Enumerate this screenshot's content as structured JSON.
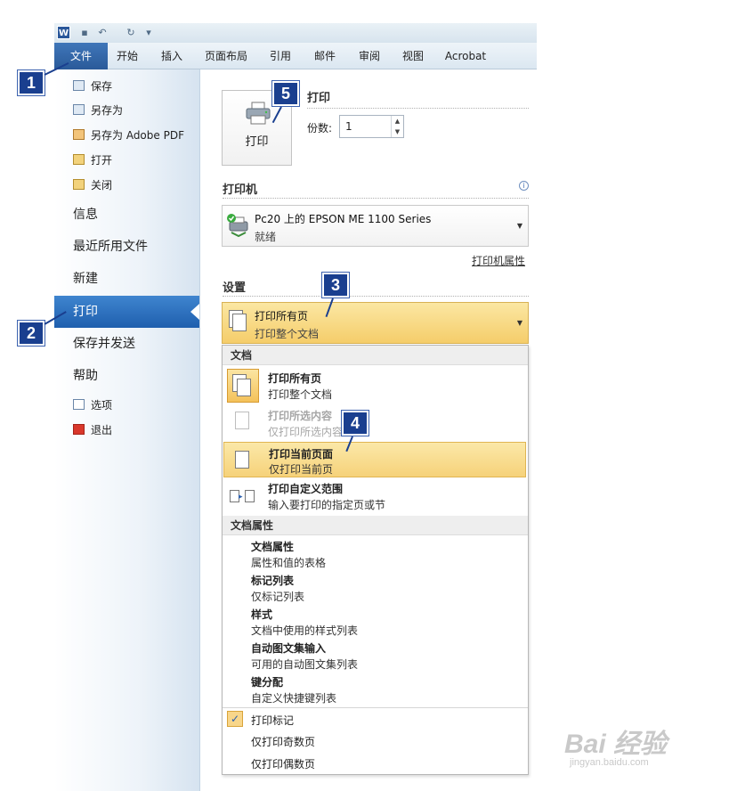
{
  "app": {
    "logo_letter": "W"
  },
  "ribbon_tabs": [
    "文件",
    "开始",
    "插入",
    "页面布局",
    "引用",
    "邮件",
    "审阅",
    "视图",
    "Acrobat"
  ],
  "nav": {
    "small_items": [
      "保存",
      "另存为",
      "另存为 Adobe PDF",
      "打开",
      "关闭"
    ],
    "big_items": [
      "信息",
      "最近所用文件",
      "新建",
      "打印",
      "保存并发送",
      "帮助"
    ],
    "bottom_items": [
      "选项",
      "退出"
    ]
  },
  "print": {
    "section_title": "打印",
    "button_label": "打印",
    "copies_label": "份数:",
    "copies_value": "1"
  },
  "printer": {
    "section_title": "打印机",
    "name": "Pc20 上的 EPSON ME 1100 Series",
    "status": "就绪",
    "properties_link": "打印机属性",
    "info_icon": "i"
  },
  "settings": {
    "section_title": "设置",
    "selected_title": "打印所有页",
    "selected_sub": "打印整个文档"
  },
  "dropdown": {
    "group1_header": "文档",
    "items": [
      {
        "title": "打印所有页",
        "sub": "打印整个文档"
      },
      {
        "title": "打印所选内容",
        "sub": "仅打印所选内容"
      },
      {
        "title": "打印当前页面",
        "sub": "仅打印当前页"
      },
      {
        "title": "打印自定义范围",
        "sub": "输入要打印的指定页或节"
      }
    ],
    "group2_header": "文档属性",
    "props": [
      {
        "title": "文档属性",
        "sub": "属性和值的表格"
      },
      {
        "title": "标记列表",
        "sub": "仅标记列表"
      },
      {
        "title": "样式",
        "sub": "文档中使用的样式列表"
      },
      {
        "title": "自动图文集输入",
        "sub": "可用的自动图文集列表"
      },
      {
        "title": "键分配",
        "sub": "自定义快捷键列表"
      }
    ],
    "options": [
      "打印标记",
      "仅打印奇数页",
      "仅打印偶数页"
    ],
    "checkmark": "✓"
  },
  "badges": [
    "1",
    "2",
    "3",
    "4",
    "5"
  ],
  "watermark": {
    "brand": "Bai 经验",
    "url": "jingyan.baidu.com"
  },
  "colors": {
    "accent_blue": "#1f5fae",
    "highlight_gold": "#f5cd6a",
    "badge_blue": "#1a3f8f"
  }
}
